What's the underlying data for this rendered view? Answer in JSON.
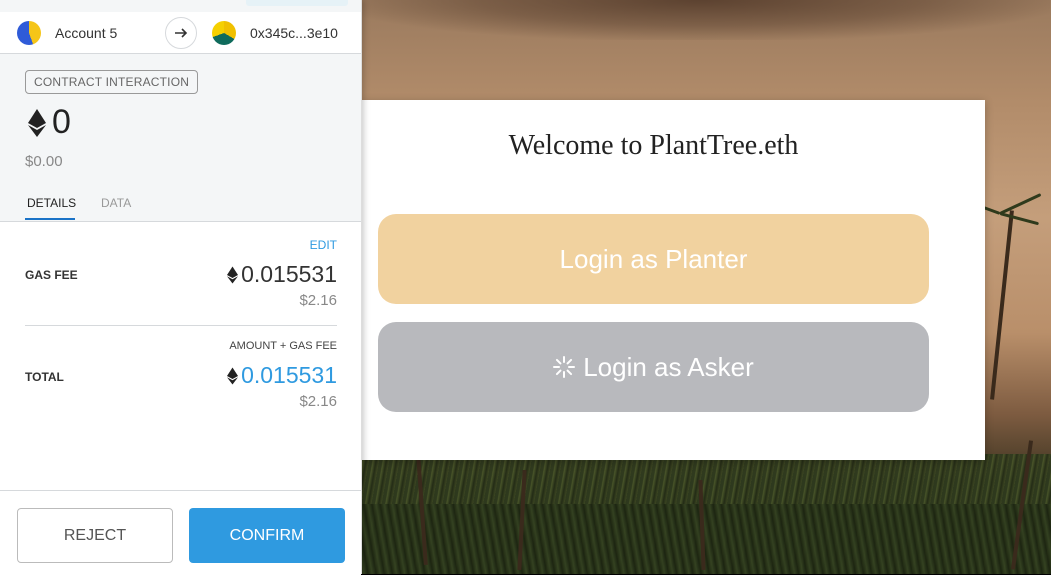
{
  "dapp": {
    "welcome_title": "Welcome to PlantTree.eth",
    "planter_button": "Login as Planter",
    "asker_button": "Login as Asker",
    "colors": {
      "planter": "#f1d29f",
      "asker": "#b8b9bd"
    }
  },
  "popup": {
    "from_account": "Account 5",
    "to_address": "0x345c...3e10",
    "badge": "CONTRACT INTERACTION",
    "amount_eth": "0",
    "amount_usd": "$0.00",
    "tabs": [
      {
        "label": "DETAILS",
        "active": true
      },
      {
        "label": "DATA",
        "active": false
      }
    ],
    "edit_label": "EDIT",
    "gas_fee": {
      "label": "GAS FEE",
      "eth": "0.015531",
      "usd": "$2.16"
    },
    "amount_plus_gas_label": "AMOUNT + GAS FEE",
    "total": {
      "label": "TOTAL",
      "eth": "0.015531",
      "usd": "$2.16"
    },
    "reject_label": "REJECT",
    "confirm_label": "CONFIRM",
    "colors": {
      "accent": "#2f9ae0"
    }
  },
  "icons": [
    "eth-icon",
    "arrow-right-icon",
    "spinner-icon",
    "account-avatar-icon",
    "recipient-avatar-icon"
  ]
}
